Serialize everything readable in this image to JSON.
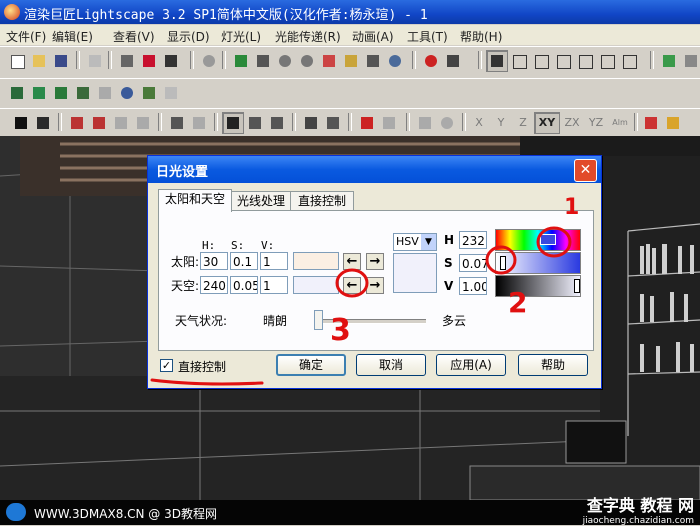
{
  "window": {
    "title": "渲染巨匠Lightscape 3.2 SP1简体中文版(汉化作者:杨永瑄) - 1"
  },
  "menu": [
    "文件(F)",
    "编辑(E)",
    "查看(V)",
    "显示(D)",
    "灯光(L)",
    "光能传递(R)",
    "动画(A)",
    "工具(T)",
    "帮助(H)"
  ],
  "toolbar3_letters": [
    "X",
    "Y",
    "Z",
    "XY",
    "ZX",
    "YZ",
    "Alm"
  ],
  "dialog": {
    "title": "日光设置",
    "close_glyph": "✕",
    "tabs": [
      "太阳和天空",
      "光线处理",
      "直接控制"
    ],
    "headers": {
      "h": "H:",
      "s": "S:",
      "v": "V:"
    },
    "sun": {
      "label": "太阳:",
      "h": "30",
      "s": "0.1",
      "v": "1",
      "swatch_color": "#fbefe3"
    },
    "sky": {
      "label": "天空:",
      "h": "240",
      "s": "0.05",
      "v": "1",
      "swatch_color": "#f1f1fb"
    },
    "arrows": {
      "left": "←",
      "right": "→"
    },
    "mode": {
      "value": "HSV",
      "dd": "▼"
    },
    "preview_color": "#f1f1fb",
    "picker": {
      "h_label": "H",
      "h_value": "232.",
      "s_label": "S",
      "s_value": "0.07",
      "v_label": "V",
      "v_value": "1.00"
    },
    "weather": {
      "label": "天气状况:",
      "left": "晴朗",
      "right": "多云",
      "slider_fraction": 0.0
    },
    "direct_control": {
      "label": "直接控制",
      "checked": true,
      "mark": "✓"
    },
    "buttons": {
      "ok": "确定",
      "cancel": "取消",
      "apply": "应用(A)",
      "help": "帮助"
    }
  },
  "annotations": {
    "one": "1",
    "two": "2",
    "three": "3"
  },
  "status": {
    "text": "WWW.3DMAX8.CN @ 3D教程网"
  },
  "watermark": {
    "big": "查字典 教程 网",
    "small": "jiaocheng.chazidian.com"
  }
}
